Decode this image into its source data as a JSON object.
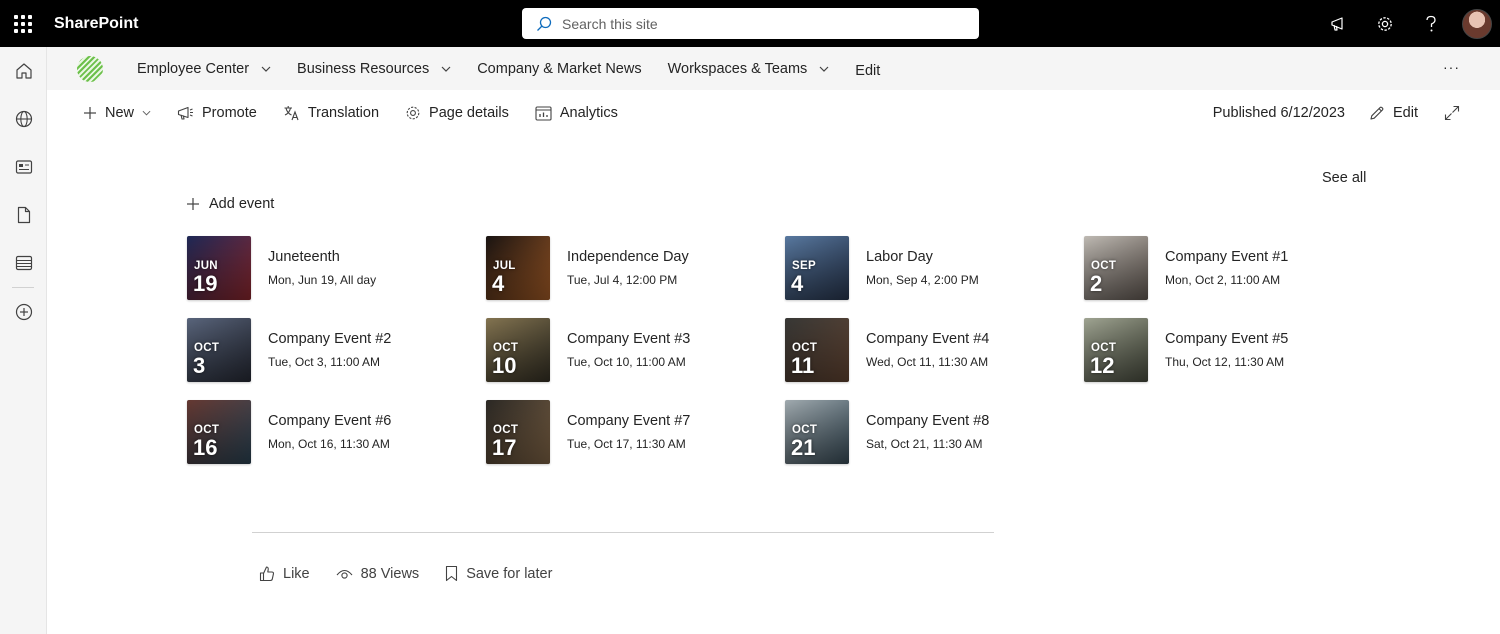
{
  "suite": {
    "app_name": "SharePoint",
    "search_placeholder": "Search this site"
  },
  "site_nav": {
    "items": [
      {
        "label": "Employee Center",
        "has_dropdown": true
      },
      {
        "label": "Business Resources",
        "has_dropdown": true
      },
      {
        "label": "Company & Market News",
        "has_dropdown": false
      },
      {
        "label": "Workspaces & Teams",
        "has_dropdown": true
      }
    ],
    "edit_label": "Edit",
    "more_label": "···"
  },
  "command_bar": {
    "new_label": "New",
    "promote_label": "Promote",
    "translation_label": "Translation",
    "page_details_label": "Page details",
    "analytics_label": "Analytics",
    "published_text": "Published 6/12/2023",
    "edit_label": "Edit"
  },
  "events_webpart": {
    "see_all_label": "See all",
    "add_event_label": "Add event",
    "events": [
      {
        "title": "Juneteenth",
        "date": "Mon, Jun 19, All day",
        "month": "JUN",
        "day": "19",
        "color_a": "#1f2a5a",
        "color_b": "#9b2b32"
      },
      {
        "title": "Independence Day",
        "date": "Tue, Jul 4, 12:00 PM",
        "month": "JUL",
        "day": "4",
        "color_a": "#1a1412",
        "color_b": "#b5652a"
      },
      {
        "title": "Labor Day",
        "date": "Mon, Sep 4, 2:00 PM",
        "month": "SEP",
        "day": "4",
        "color_a": "#5d7fa8",
        "color_b": "#2c3b55"
      },
      {
        "title": "Company Event #1",
        "date": "Mon, Oct 2, 11:00 AM",
        "month": "OCT",
        "day": "2",
        "color_a": "#c9c4bd",
        "color_b": "#6b615a"
      },
      {
        "title": "Company Event #2",
        "date": "Tue, Oct 3, 11:00 AM",
        "month": "OCT",
        "day": "3",
        "color_a": "#5e6a82",
        "color_b": "#2a2e3a"
      },
      {
        "title": "Company Event #3",
        "date": "Tue, Oct 10, 11:00 AM",
        "month": "OCT",
        "day": "10",
        "color_a": "#8a7a55",
        "color_b": "#3a3528"
      },
      {
        "title": "Company Event #4",
        "date": "Wed, Oct 11, 11:30 AM",
        "month": "OCT",
        "day": "11",
        "color_a": "#3a3a38",
        "color_b": "#6b4a36"
      },
      {
        "title": "Company Event #5",
        "date": "Thu, Oct 12, 11:30 AM",
        "month": "OCT",
        "day": "12",
        "color_a": "#a8ad9a",
        "color_b": "#4f5344"
      },
      {
        "title": "Company Event #6",
        "date": "Mon, Oct 16, 11:30 AM",
        "month": "OCT",
        "day": "16",
        "color_a": "#6a3b34",
        "color_b": "#2f4a5c"
      },
      {
        "title": "Company Event #7",
        "date": "Tue, Oct 17, 11:30 AM",
        "month": "OCT",
        "day": "17",
        "color_a": "#2d2a26",
        "color_b": "#8b6d4c"
      },
      {
        "title": "Company Event #8",
        "date": "Sat, Oct 21, 11:30 AM",
        "month": "OCT",
        "day": "21",
        "color_a": "#a9b3b8",
        "color_b": "#3e5360"
      }
    ]
  },
  "social_bar": {
    "like_label": "Like",
    "views_label": "88 Views",
    "save_label": "Save for later"
  }
}
